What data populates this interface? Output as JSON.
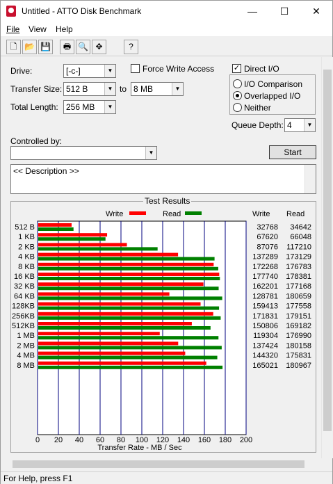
{
  "window": {
    "title": "Untitled - ATTO Disk Benchmark",
    "minimize": "—",
    "maximize": "☐",
    "close": "✕"
  },
  "menu": {
    "file": "File",
    "view": "View",
    "help": "Help"
  },
  "toolbar": {
    "new": "🗋",
    "open": "📂",
    "save": "💾",
    "print": "🖶",
    "preview": "🔍",
    "move": "✥",
    "help": "?"
  },
  "form": {
    "drive_label": "Drive:",
    "drive_value": "[-c-]",
    "transfer_size_label": "Transfer Size:",
    "transfer_from": "512 B",
    "transfer_to_label": "to",
    "transfer_to": "8 MB",
    "total_length_label": "Total Length:",
    "total_length": "256 MB",
    "force_write_label": "Force Write Access",
    "direct_io_label": "Direct I/O",
    "io_comparison_label": "I/O Comparison",
    "overlapped_io_label": "Overlapped I/O",
    "neither_label": "Neither",
    "queue_depth_label": "Queue Depth:",
    "queue_depth": "4",
    "controlled_by_label": "Controlled by:",
    "controlled_by": "",
    "start_label": "Start",
    "description": "<< Description >>"
  },
  "results": {
    "title": "Test Results",
    "legend_write": "Write",
    "legend_read": "Read",
    "col_write": "Write",
    "col_read": "Read",
    "xlabel": "Transfer Rate - MB / Sec"
  },
  "colors": {
    "write": "#ff0000",
    "read": "#008000",
    "grid": "#00007f"
  },
  "chart_data": {
    "type": "bar",
    "orientation": "horizontal",
    "categories": [
      "512 B",
      "1 KB",
      "2 KB",
      "4 KB",
      "8 KB",
      "16 KB",
      "32 KB",
      "64 KB",
      "128KB",
      "256KB",
      "512KB",
      "1 MB",
      "2 MB",
      "4 MB",
      "8 MB"
    ],
    "series": [
      {
        "name": "Write",
        "values": [
          32768,
          67620,
          87076,
          137289,
          172268,
          177740,
          162201,
          128781,
          159413,
          171831,
          150806,
          119304,
          137424,
          144320,
          165021
        ]
      },
      {
        "name": "Read",
        "values": [
          34642,
          66048,
          117210,
          173129,
          176783,
          178381,
          177168,
          180659,
          177558,
          179151,
          169182,
          176990,
          180158,
          175831,
          180967
        ]
      }
    ],
    "value_units": "KB/s",
    "xlabel": "Transfer Rate - MB / Sec",
    "xlim": [
      0,
      200
    ],
    "xticks": [
      "0",
      "20",
      "40",
      "60",
      "80",
      "100",
      "120",
      "140",
      "160",
      "180",
      "200"
    ],
    "grid": true,
    "legend": "top"
  },
  "status": {
    "text": "For Help, press F1"
  }
}
